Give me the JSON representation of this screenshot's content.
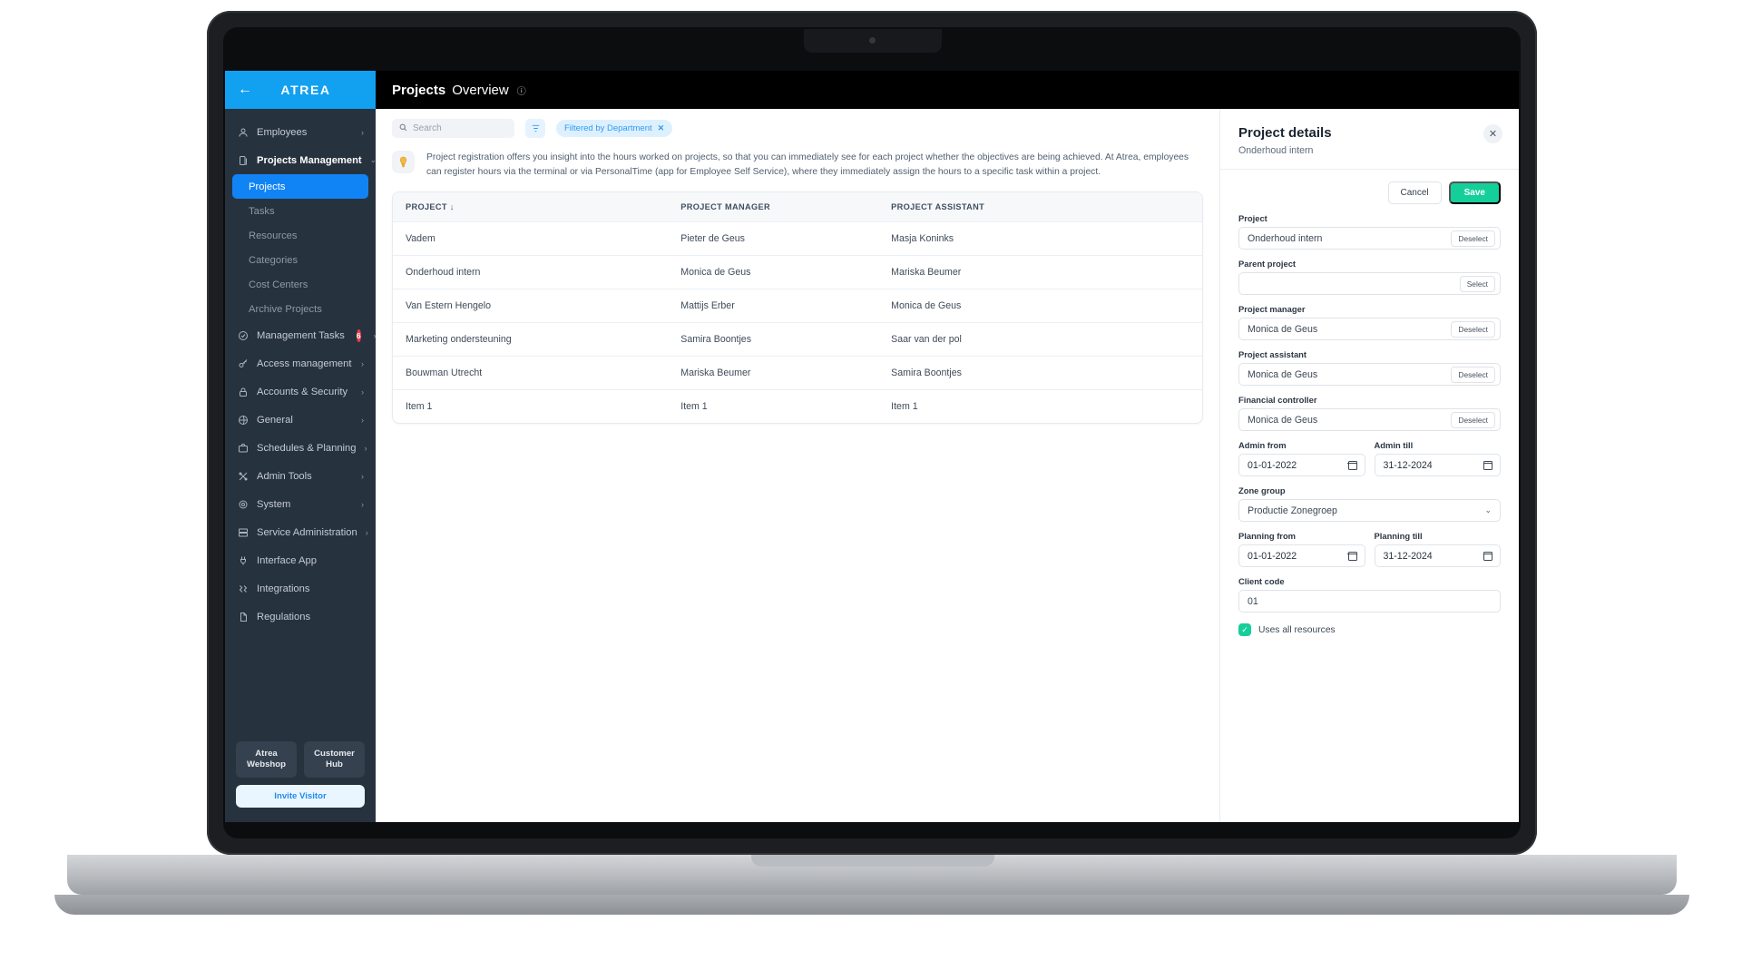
{
  "brand": {
    "name": "ATREA",
    "back_icon": "arrow-left-icon"
  },
  "sidebar": {
    "items": [
      {
        "label": "Employees",
        "icon": "user-icon",
        "chevron": "›",
        "type": "parent"
      },
      {
        "label": "Projects Management",
        "icon": "copy-icon",
        "chevron": "⌄",
        "type": "parent-open"
      },
      {
        "label": "Projects",
        "type": "sub",
        "selected": true
      },
      {
        "label": "Tasks",
        "type": "sub"
      },
      {
        "label": "Resources",
        "type": "sub"
      },
      {
        "label": "Categories",
        "type": "sub"
      },
      {
        "label": "Cost Centers",
        "type": "sub"
      },
      {
        "label": "Archive Projects",
        "type": "sub"
      },
      {
        "label": "Management Tasks",
        "icon": "check-circle-icon",
        "chevron": "›",
        "type": "parent",
        "badge": "6"
      },
      {
        "label": "Access management",
        "icon": "key-icon",
        "chevron": "›",
        "type": "parent"
      },
      {
        "label": "Accounts & Security",
        "icon": "lock-icon",
        "chevron": "›",
        "type": "parent"
      },
      {
        "label": "General",
        "icon": "globe-icon",
        "chevron": "›",
        "type": "parent"
      },
      {
        "label": "Schedules & Planning",
        "icon": "briefcase-icon",
        "chevron": "›",
        "type": "parent"
      },
      {
        "label": "Admin Tools",
        "icon": "tools-icon",
        "chevron": "›",
        "type": "parent"
      },
      {
        "label": "System",
        "icon": "gear-icon",
        "chevron": "›",
        "type": "parent"
      },
      {
        "label": "Service Administration",
        "icon": "server-icon",
        "chevron": "›",
        "type": "parent"
      },
      {
        "label": "Interface App",
        "icon": "plug-icon",
        "type": "parent"
      },
      {
        "label": "Integrations",
        "icon": "link-icon",
        "type": "parent"
      },
      {
        "label": "Regulations",
        "icon": "document-icon",
        "type": "parent"
      }
    ],
    "webshop_button": "Atrea Webshop",
    "customer_hub_button": "Customer Hub",
    "invite_button": "Invite Visitor"
  },
  "topbar": {
    "title_bold": "Projects",
    "title_regular": "Overview",
    "help_icon": "help-circle-icon"
  },
  "toolbar": {
    "search_placeholder": "Search",
    "search_value": "",
    "search_icon": "search-icon",
    "filter_icon": "filter-icon",
    "chip_label": "Filtered by Department",
    "chip_close": "✕"
  },
  "notice": {
    "icon": "lightbulb-icon",
    "text": "Project registration offers you insight into the hours worked on projects, so that you can immediately see for each project whether the objectives are being achieved. At Atrea, employees can register hours via the terminal or via PersonalTime (app for Employee Self Service), where they immediately assign the hours to a specific task within a project."
  },
  "table": {
    "columns": [
      "PROJECT ↓",
      "PROJECT MANAGER",
      "PROJECT ASSISTANT"
    ],
    "rows": [
      [
        "Vadem",
        "Pieter de Geus",
        "Masja Koninks"
      ],
      [
        "Onderhoud intern",
        "Monica de Geus",
        "Mariska Beumer"
      ],
      [
        "Van Estern Hengelo",
        "Mattijs Erber",
        "Monica de Geus"
      ],
      [
        "Marketing ondersteuning",
        "Samira Boontjes",
        "Saar van der pol"
      ],
      [
        "Bouwman Utrecht",
        "Mariska Beumer",
        "Samira Boontjes"
      ],
      [
        "Item 1",
        "Item 1",
        "Item 1"
      ]
    ]
  },
  "panel": {
    "title": "Project details",
    "subtitle": "Onderhoud intern",
    "close_icon": "close-icon",
    "cancel_label": "Cancel",
    "save_label": "Save",
    "fields": {
      "project": {
        "label": "Project",
        "value": "Onderhoud intern",
        "button": "Deselect"
      },
      "parent_project": {
        "label": "Parent project",
        "value": "",
        "button": "Select"
      },
      "project_manager": {
        "label": "Project manager",
        "value": "Monica de Geus",
        "button": "Deselect"
      },
      "project_assistant": {
        "label": "Project assistant",
        "value": "Monica de Geus",
        "button": "Deselect"
      },
      "financial_controller": {
        "label": "Financial controller",
        "value": "Monica de Geus",
        "button": "Deselect"
      },
      "admin_from": {
        "label": "Admin from",
        "value": "01-01-2022"
      },
      "admin_till": {
        "label": "Admin till",
        "value": "31-12-2024"
      },
      "zone_group": {
        "label": "Zone group",
        "value": "Productie Zonegroep"
      },
      "planning_from": {
        "label": "Planning from",
        "value": "01-01-2022"
      },
      "planning_till": {
        "label": "Planning till",
        "value": "31-12-2024"
      },
      "client_code": {
        "label": "Client code",
        "value": "01"
      },
      "uses_all_resources": {
        "label": "Uses all resources",
        "checked": true,
        "check_glyph": "✓"
      }
    }
  },
  "colors": {
    "brand_blue": "#12a0f0",
    "sidebar_bg": "#27323f",
    "selected_blue": "#1184f5",
    "save_green": "#15cf9a",
    "badge_red": "#ec3b48",
    "chip_blue": "#2e9cf3"
  }
}
